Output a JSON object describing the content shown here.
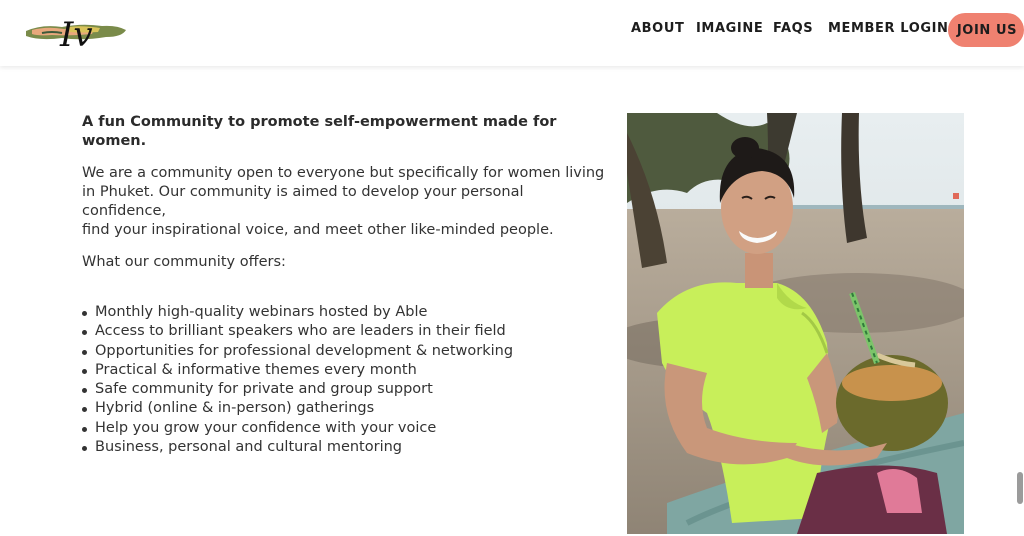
{
  "brand": {
    "logo_text": "Iv"
  },
  "nav": {
    "items": [
      {
        "label": "ABOUT"
      },
      {
        "label": "IMAGINE"
      },
      {
        "label": "FAQS"
      },
      {
        "label": "MEMBER LOGIN"
      }
    ],
    "cta_label": "JOIN US",
    "cta_color": "#ef8170"
  },
  "main": {
    "intro": "A fun Community to promote self-empowerment made for women.",
    "description_lines": [
      "We are a community open to everyone but specifically for women living",
      "in Phuket. Our community is aimed to develop your personal confidence,",
      "find your inspirational voice, and meet other like-minded people."
    ],
    "offers_heading": "What our community offers:",
    "features": [
      "Monthly high-quality webinars hosted by Able",
      "Access to brilliant speakers who are leaders in their field",
      "Opportunities for professional development & networking",
      "Practical & informative themes every month",
      "Safe community for private and group support",
      "Hybrid (online & in-person) gatherings",
      "Help you grow your confidence with your voice",
      "Business, personal and cultural mentoring"
    ]
  },
  "photo": {
    "icon": "photo-woman-with-coconut"
  }
}
